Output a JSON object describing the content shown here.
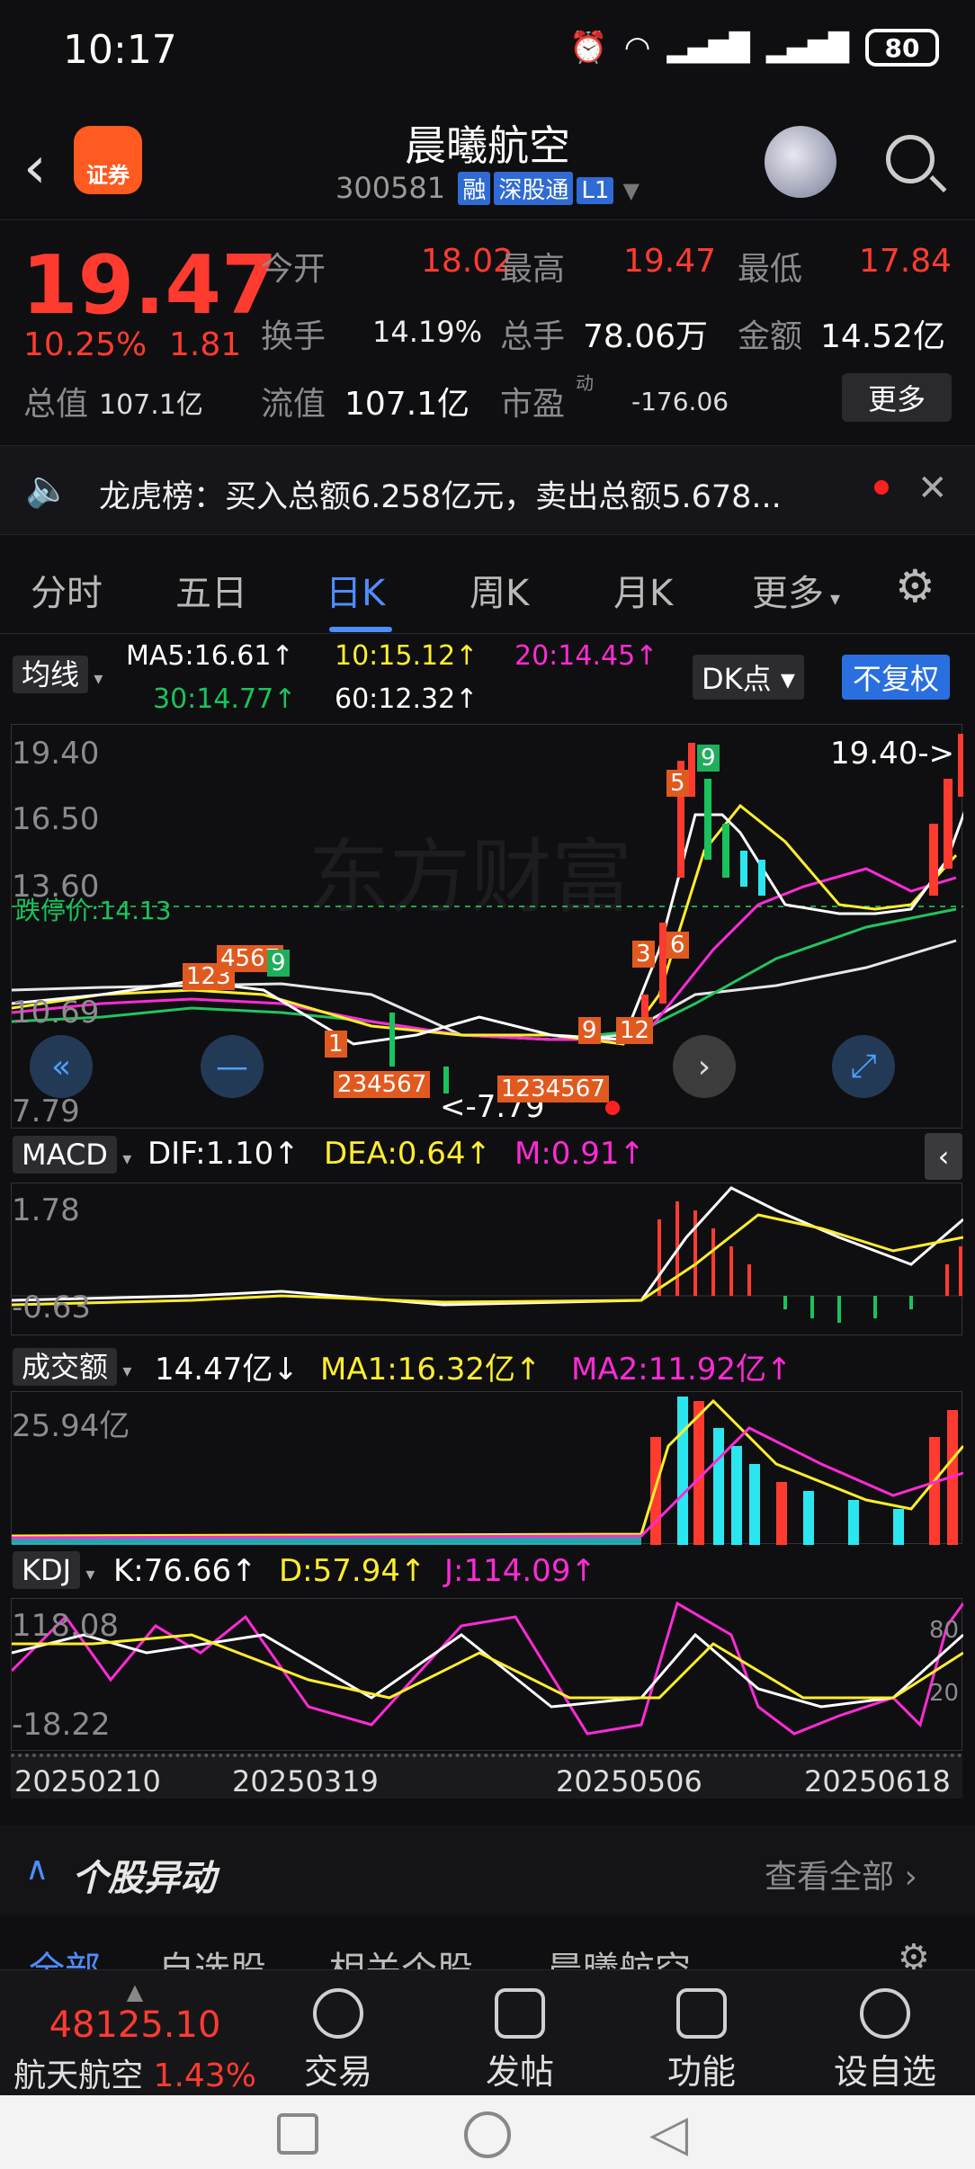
{
  "status": {
    "time": "10:17",
    "battery": "80"
  },
  "header": {
    "logo_text": "证券",
    "title": "晨曦航空",
    "code": "300581",
    "tags": [
      "融",
      "深股通",
      "L1"
    ]
  },
  "quote": {
    "price": "19.47",
    "change_pct": "10.25%",
    "change_amt": "1.81",
    "open_label": "今开",
    "open": "18.02",
    "high_label": "最高",
    "high": "19.47",
    "low_label": "最低",
    "low": "17.84",
    "turnover_label": "换手",
    "turnover": "14.19%",
    "volume_label": "总手",
    "volume": "78.06万",
    "amount_label": "金额",
    "amount": "14.52亿",
    "mcap_label": "总值",
    "mcap": "107.1亿",
    "float_label": "流值",
    "float": "107.1亿",
    "pe_label": "市盈",
    "pe_sup": "动",
    "pe": "-176.06",
    "more": "更多"
  },
  "notice": {
    "text": "龙虎榜：买入总额6.258亿元，卖出总额5.678..."
  },
  "tabs": [
    "分时",
    "五日",
    "日K",
    "周K",
    "月K",
    "更多"
  ],
  "ma_row": {
    "label": "均线",
    "ma5": "MA5:16.61↑",
    "ma10": "10:15.12↑",
    "ma20": "20:14.45↑",
    "ma30": "30:14.77↑",
    "ma60": "60:12.32↑",
    "dk": "DK点",
    "fq": "不复权"
  },
  "kline": {
    "y_top": "19.40",
    "y2": "16.50",
    "y3": "13.60",
    "y4": "10.69",
    "y_bottom": "7.79",
    "limit_label": "跌停价:14.13",
    "last_marker": "19.40->",
    "low_marker": "<-7.79",
    "watermark": "东方财富"
  },
  "macd": {
    "label": "MACD",
    "dif": "DIF:1.10↑",
    "dea": "DEA:0.64↑",
    "m": "M:0.91↑",
    "y_top": "1.78",
    "y_bottom": "-0.63"
  },
  "vol": {
    "label": "成交额",
    "v": "14.47亿↓",
    "ma1": "MA1:16.32亿↑",
    "ma2": "MA2:11.92亿↑",
    "y_top": "25.94亿"
  },
  "kdj": {
    "label": "KDJ",
    "k": "K:76.66↑",
    "d": "D:57.94↑",
    "j": "J:114.09↑",
    "y_top": "118.08",
    "y_bottom": "-18.22",
    "r80": "80",
    "r20": "20"
  },
  "dates": [
    "20250210",
    "20250319",
    "20250506",
    "20250618"
  ],
  "section": {
    "title": "个股异动",
    "view_all": "查看全部"
  },
  "subtabs": [
    "全部",
    "自选股",
    "相关个股",
    "晨曦航空"
  ],
  "bottom": {
    "index_value": "48125.10",
    "index_name": "航天航空",
    "index_pct": "1.43%",
    "items": [
      "交易",
      "发帖",
      "功能",
      "设自选"
    ]
  }
}
